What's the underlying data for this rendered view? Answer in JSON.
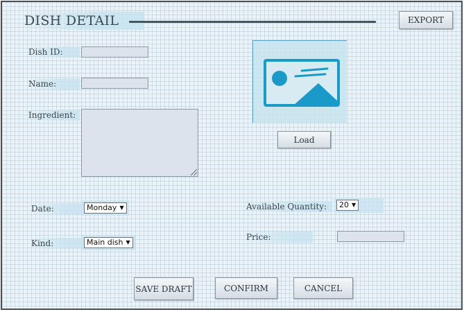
{
  "header": {
    "title": "DISH DETAIL",
    "export_label": "EXPORT"
  },
  "form": {
    "dish_id": {
      "label": "Dish ID:",
      "value": ""
    },
    "name": {
      "label": "Name:",
      "value": ""
    },
    "ingredient": {
      "label": "Ingredient:",
      "value": ""
    },
    "date": {
      "label": "Date:",
      "selected": "Monday"
    },
    "kind": {
      "label": "Kind:",
      "selected": "Main dish"
    },
    "available_quantity": {
      "label": "Available Quantity:",
      "selected": "20"
    },
    "price": {
      "label": "Price:",
      "value": ""
    }
  },
  "image": {
    "icon": "image-placeholder-icon",
    "load_label": "Load",
    "accent": "#1a9ac9"
  },
  "actions": {
    "save_draft": "SAVE DRAFT",
    "confirm": "CONFIRM",
    "cancel": "CANCEL"
  }
}
